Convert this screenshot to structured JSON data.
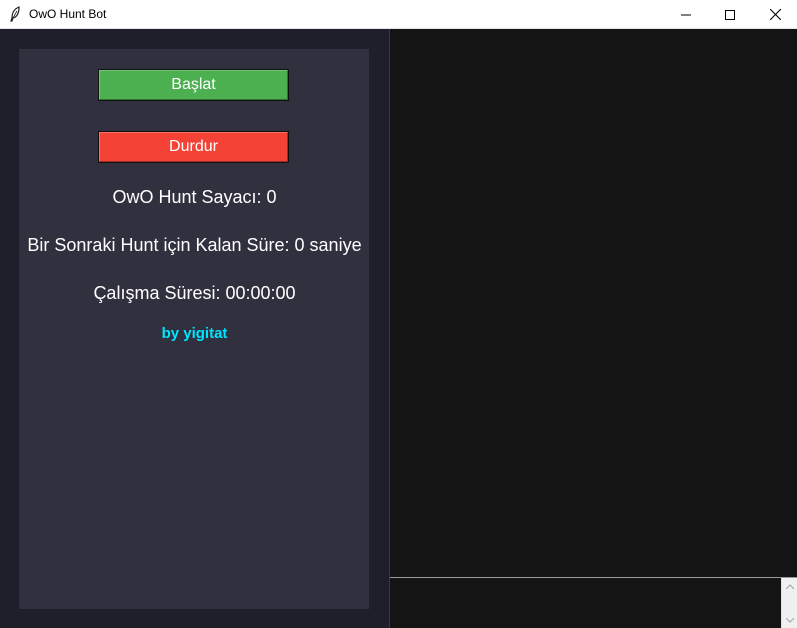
{
  "window": {
    "title": "OwO Hunt Bot",
    "icon": "feather-icon"
  },
  "controls": {
    "start_label": "Başlat",
    "stop_label": "Durdur"
  },
  "stats": {
    "counter_text": "OwO Hunt Sayacı: 0",
    "remaining_text": "Bir Sonraki Hunt için Kalan Süre: 0 saniye",
    "uptime_text": "Çalışma Süresi: 00:00:00"
  },
  "credit": {
    "text": "by yigitat"
  },
  "colors": {
    "start": "#4caf50",
    "stop": "#f44336",
    "credit": "#00e5ff",
    "panel": "#30303e",
    "background": "#1f1f2b",
    "output": "#141414"
  }
}
